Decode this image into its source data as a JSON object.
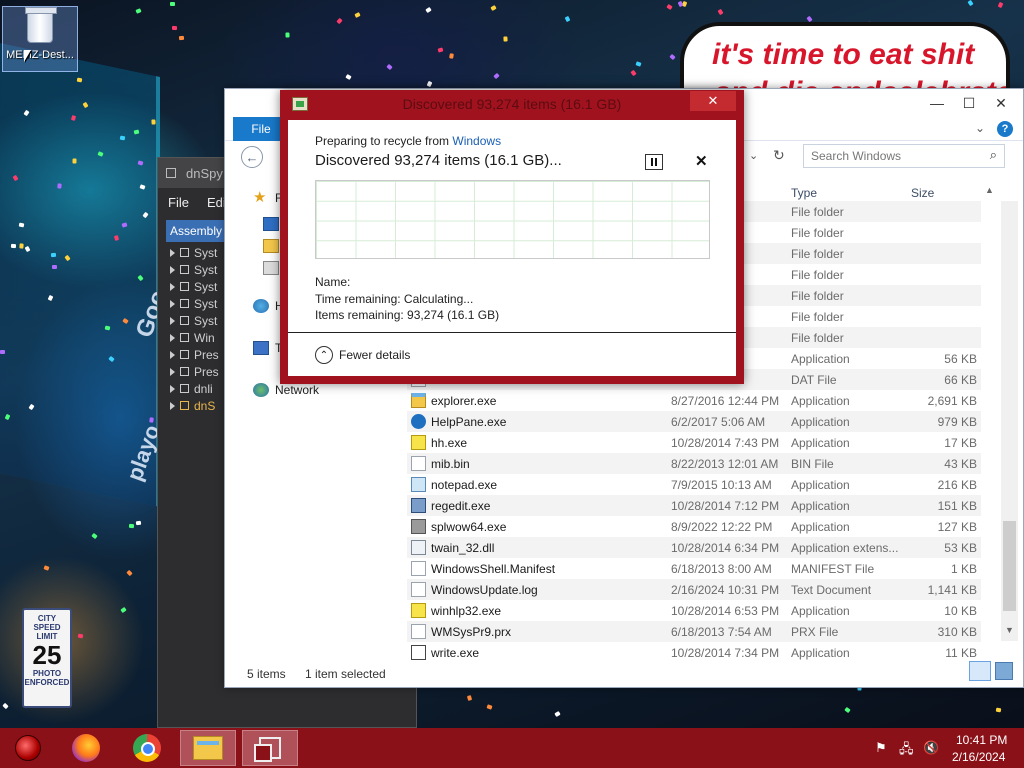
{
  "desktop": {
    "icons": [
      {
        "label": "MEMZ-Dest..."
      }
    ],
    "speech_bubble": {
      "line1": "it's time to eat shit",
      "line2": "and die andcelebrate"
    },
    "billboard_text": [
      "Goo",
      "playo"
    ],
    "street_sign": {
      "line1": "CITY",
      "line2": "SPEED",
      "line3": "LIMIT",
      "value": "25",
      "line4": "PHOTO",
      "line5": "ENFORCED"
    }
  },
  "dnspy": {
    "title": "dnSpy v",
    "menu": [
      "File",
      "Edit"
    ],
    "tab": "Assembly E",
    "tree": [
      {
        "label": "Syst",
        "highlight": false
      },
      {
        "label": "Syst",
        "highlight": false
      },
      {
        "label": "Syst",
        "highlight": false
      },
      {
        "label": "Syst",
        "highlight": false
      },
      {
        "label": "Syst",
        "highlight": false
      },
      {
        "label": "Win",
        "highlight": false
      },
      {
        "label": "Pres",
        "highlight": false
      },
      {
        "label": "Pres",
        "highlight": false
      },
      {
        "label": "dnli",
        "highlight": false
      },
      {
        "label": "dnS",
        "highlight": true
      }
    ]
  },
  "explorer": {
    "ribbon": {
      "file_tab": "File"
    },
    "window_controls": {
      "minimize": "—",
      "maximize": "☐",
      "close": "✕"
    },
    "search_placeholder": "Search Windows",
    "nav": [
      {
        "label": "Fa",
        "icon": "star-icon"
      },
      {
        "label": "H",
        "icon": "homegroup-icon"
      },
      {
        "label": "T",
        "icon": "computer-icon"
      },
      {
        "label": "Network",
        "icon": "network-icon"
      }
    ],
    "columns": {
      "type": "Type",
      "size": "Size"
    },
    "rows": [
      {
        "name": "",
        "date": "AM",
        "type": "File folder",
        "size": "",
        "icon": "folder"
      },
      {
        "name": "",
        "date": "2 AM",
        "type": "File folder",
        "size": "",
        "icon": "folder"
      },
      {
        "name": "",
        "date": "5 AM",
        "type": "File folder",
        "size": "",
        "icon": "folder"
      },
      {
        "name": "",
        "date": "5 AM",
        "type": "File folder",
        "size": "",
        "icon": "folder"
      },
      {
        "name": "",
        "date": "5 AM",
        "type": "File folder",
        "size": "",
        "icon": "folder"
      },
      {
        "name": "",
        "date": "2 AM",
        "type": "File folder",
        "size": "",
        "icon": "folder"
      },
      {
        "name": "",
        "date": "4 PM",
        "type": "File folder",
        "size": "",
        "icon": "folder"
      },
      {
        "name": "",
        "date": "AM",
        "type": "Application",
        "size": "56 KB",
        "icon": "app"
      },
      {
        "name": "",
        "date": "27 PM",
        "type": "DAT File",
        "size": "66 KB",
        "icon": "file"
      },
      {
        "name": "explorer.exe",
        "date": "8/27/2016 12:44 PM",
        "type": "Application",
        "size": "2,691 KB",
        "icon": "explorer"
      },
      {
        "name": "HelpPane.exe",
        "date": "6/2/2017 5:06 AM",
        "type": "Application",
        "size": "979 KB",
        "icon": "help"
      },
      {
        "name": "hh.exe",
        "date": "10/28/2014 7:43 PM",
        "type": "Application",
        "size": "17 KB",
        "icon": "question"
      },
      {
        "name": "mib.bin",
        "date": "8/22/2013 12:01 AM",
        "type": "BIN File",
        "size": "43 KB",
        "icon": "file"
      },
      {
        "name": "notepad.exe",
        "date": "7/9/2015 10:13 AM",
        "type": "Application",
        "size": "216 KB",
        "icon": "notepad"
      },
      {
        "name": "regedit.exe",
        "date": "10/28/2014 7:12 PM",
        "type": "Application",
        "size": "151 KB",
        "icon": "regedit"
      },
      {
        "name": "splwow64.exe",
        "date": "8/9/2022 12:22 PM",
        "type": "Application",
        "size": "127 KB",
        "icon": "printer"
      },
      {
        "name": "twain_32.dll",
        "date": "10/28/2014 6:34 PM",
        "type": "Application extens...",
        "size": "53 KB",
        "icon": "dll"
      },
      {
        "name": "WindowsShell.Manifest",
        "date": "6/18/2013 8:00 AM",
        "type": "MANIFEST File",
        "size": "1 KB",
        "icon": "file"
      },
      {
        "name": "WindowsUpdate.log",
        "date": "2/16/2024 10:31 PM",
        "type": "Text Document",
        "size": "1,141 KB",
        "icon": "file"
      },
      {
        "name": "winhlp32.exe",
        "date": "10/28/2014 6:53 PM",
        "type": "Application",
        "size": "10 KB",
        "icon": "question"
      },
      {
        "name": "WMSysPr9.prx",
        "date": "6/18/2013 7:54 AM",
        "type": "PRX File",
        "size": "310 KB",
        "icon": "file"
      },
      {
        "name": "write.exe",
        "date": "10/28/2014 7:34 PM",
        "type": "Application",
        "size": "11 KB",
        "icon": "write"
      }
    ],
    "status": {
      "count": "5 items",
      "selected": "1 item selected"
    }
  },
  "progress_dialog": {
    "title": "Discovered 93,274 items (16.1 GB)",
    "close": "✕",
    "from_prefix": "Preparing to recycle from ",
    "from_link": "Windows",
    "headline": "Discovered 93,274 items (16.1 GB)...",
    "cancel": "✕",
    "name_label": "Name:",
    "time_remaining": "Time remaining:  Calculating...",
    "items_remaining": "Items remaining:  93,274 (16.1 GB)",
    "details_button": "Fewer details"
  },
  "taskbar": {
    "apps": [
      "start-orb",
      "firefox",
      "chrome",
      "file-explorer",
      "dnspy"
    ],
    "clock_time": "10:41 PM",
    "clock_date": "2/16/2024"
  },
  "colors": {
    "accent": "#a0131e",
    "taskbar": "#8a1118",
    "ribbon_blue": "#1979ca",
    "link": "#1a5fb4"
  }
}
